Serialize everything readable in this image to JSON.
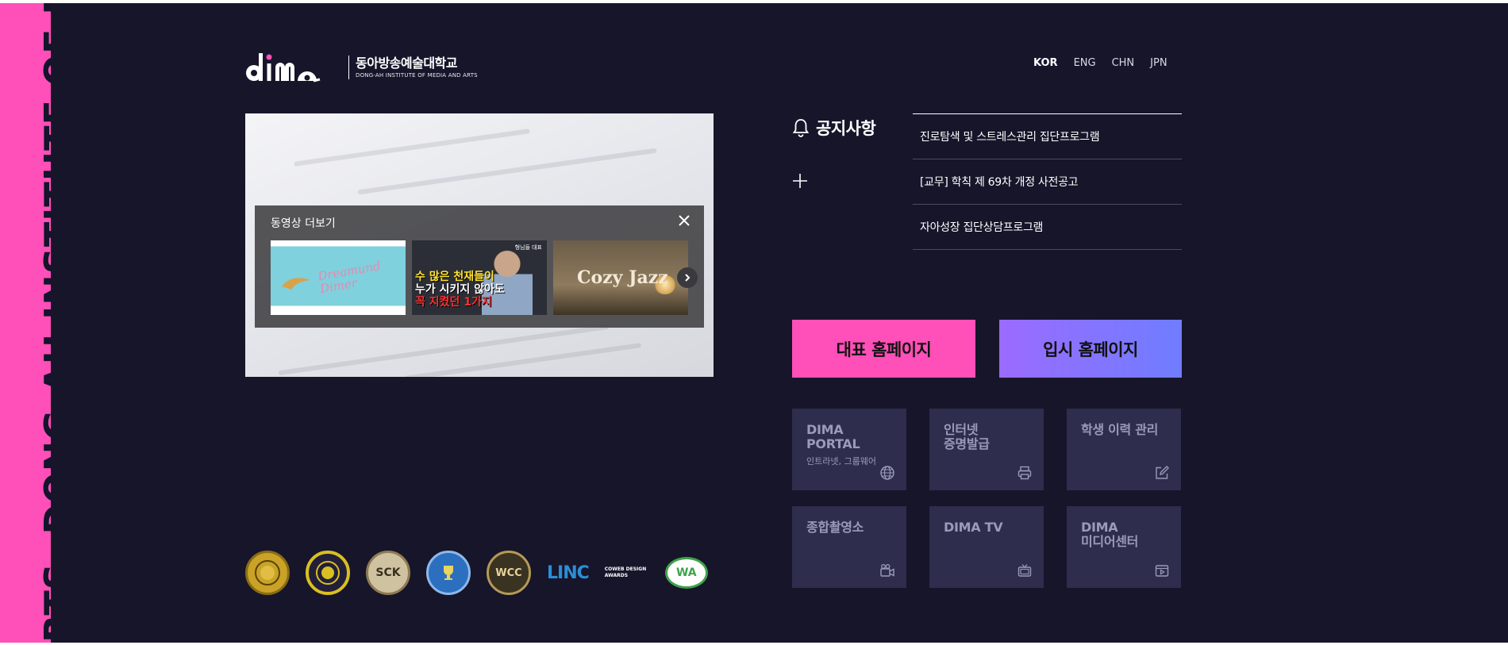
{
  "side_banner": {
    "text": "RTS.  DONG-AH INSTITUTE OF MEDIA AND ARTS"
  },
  "logo": {
    "mark": "dima",
    "korean": "동아방송예술대학교",
    "english": "DONG-AH INSTITUTE OF MEDIA AND ARTS"
  },
  "languages": [
    {
      "label": "KOR",
      "active": true
    },
    {
      "label": "ENG",
      "active": false
    },
    {
      "label": "CHN",
      "active": false
    },
    {
      "label": "JPN",
      "active": false
    }
  ],
  "video_panel": {
    "title": "동영상 더보기",
    "thumbnails": [
      {
        "caption": "Dreamund Dimer"
      },
      {
        "tag": "형님들 대표",
        "line1": "수 많은 천재들이",
        "line2": "누가 시키지 않아도",
        "line3": "꼭 지켰던 1가지"
      },
      {
        "caption": "Cozy Jazz"
      }
    ]
  },
  "notice": {
    "title": "공지사항",
    "items": [
      "진로탐색 및 스트레스관리 집단프로그램",
      "[교무] 학칙 제 69차 개정 사전공고",
      "자아성장 집단상담프로그램"
    ]
  },
  "buttons": {
    "main_site": "대표 홈페이지",
    "admission_site": "입시 홈페이지"
  },
  "tiles": [
    {
      "label": "DIMA\nPORTAL",
      "sub": "인트라넷, 그룹웨어",
      "icon": "globe-icon"
    },
    {
      "label": "인터넷\n증명발급",
      "sub": "",
      "icon": "printer-icon"
    },
    {
      "label": "학생 이력 관리",
      "sub": "",
      "icon": "edit-icon"
    },
    {
      "label": "종합촬영소",
      "sub": "",
      "icon": "video-camera-icon"
    },
    {
      "label": "DIMA TV",
      "sub": "",
      "icon": "tv-icon"
    },
    {
      "label": "DIMA\n미디어센터",
      "sub": "",
      "icon": "media-player-icon"
    }
  ],
  "badges": [
    {
      "text": "",
      "kind": "seal",
      "color": "#c9a227"
    },
    {
      "text": "",
      "kind": "seal",
      "color": "#d8c020"
    },
    {
      "text": "SCK",
      "kind": "seal",
      "color": "#a8946a"
    },
    {
      "text": "",
      "kind": "seal",
      "color": "#2c6fbf"
    },
    {
      "text": "WCC",
      "kind": "seal",
      "color": "#b59a55"
    },
    {
      "text": "LINC",
      "kind": "logo",
      "color": "#2b8ed6"
    },
    {
      "text": "COWEB DESIGN AWARDS",
      "kind": "logo",
      "color": "#ffffff"
    },
    {
      "text": "WA",
      "kind": "logo",
      "color": "#3ea34a"
    }
  ],
  "colors": {
    "background": "#17152a",
    "accent_pink": "#ff4fb8",
    "accent_purple": "#7d78ff",
    "tile_bg": "#2e2d4d"
  }
}
